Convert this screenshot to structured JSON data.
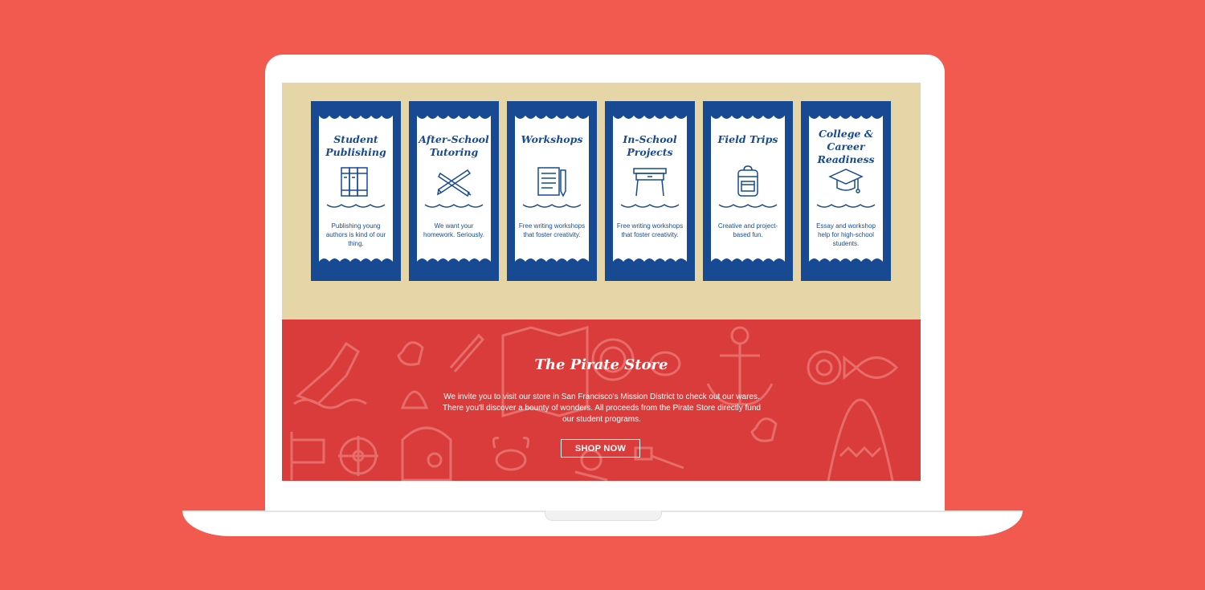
{
  "programs": [
    {
      "title": "Student Publishing",
      "icon": "books-icon",
      "desc": "Publishing young authors is kind of our thing."
    },
    {
      "title": "After-School Tutoring",
      "icon": "pencils-icon",
      "desc": "We want your homework. Seriously."
    },
    {
      "title": "Workshops",
      "icon": "notebook-icon",
      "desc": "Free writing workshops that foster creativity."
    },
    {
      "title": "In-School Projects",
      "icon": "desk-icon",
      "desc": "Free writing workshops that foster creativity."
    },
    {
      "title": "Field Trips",
      "icon": "backpack-icon",
      "desc": "Creative and project-based fun."
    },
    {
      "title": "College & Career Readiness",
      "icon": "graduation-cap-icon",
      "desc": "Essay and workshop help for high-school students."
    }
  ],
  "store": {
    "title": "The Pirate Store",
    "text": "We invite you to visit our store in San Francisco's Mission District to check out our wares. There you'll discover a bounty of wonders. All proceeds from the Pirate Store directly fund our student programs.",
    "button": "SHOP NOW"
  },
  "colors": {
    "background": "#f25a50",
    "navy": "#174a92",
    "sand": "#e6d5a6",
    "store_red": "#d93c3b"
  }
}
